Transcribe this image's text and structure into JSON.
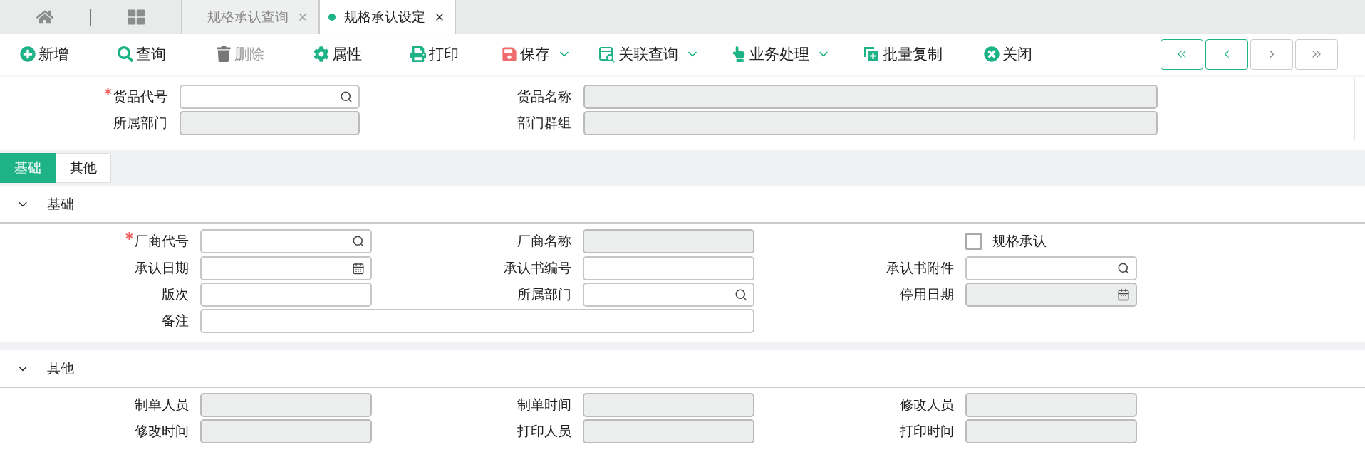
{
  "page_tabs": [
    {
      "label": "规格承认查询",
      "selected": false
    },
    {
      "label": "规格承认设定",
      "selected": true
    }
  ],
  "toolbar": [
    {
      "kind": "add",
      "label": "新增",
      "disabled": false,
      "dropdown": false
    },
    {
      "kind": "search",
      "label": "查询",
      "disabled": false,
      "dropdown": false
    },
    {
      "kind": "delete",
      "label": "删除",
      "disabled": true,
      "dropdown": false
    },
    {
      "kind": "settings",
      "label": "属性",
      "disabled": false,
      "dropdown": false
    },
    {
      "kind": "print",
      "label": "打印",
      "disabled": false,
      "dropdown": false
    },
    {
      "kind": "save",
      "label": "保存",
      "disabled": false,
      "dropdown": true
    },
    {
      "kind": "link",
      "label": "关联查询",
      "disabled": false,
      "dropdown": true
    },
    {
      "kind": "hand",
      "label": "业务处理",
      "disabled": false,
      "dropdown": true
    },
    {
      "kind": "copy",
      "label": "批量复制",
      "disabled": false,
      "dropdown": false
    },
    {
      "kind": "close",
      "label": "关闭",
      "disabled": false,
      "dropdown": false
    }
  ],
  "nav_buttons": [
    {
      "kind": "first",
      "disabled": false
    },
    {
      "kind": "prev",
      "disabled": false
    },
    {
      "kind": "next",
      "disabled": true
    },
    {
      "kind": "last",
      "disabled": true
    }
  ],
  "header_rows": [
    [
      {
        "label": "货品代号",
        "required": true,
        "readonly": false,
        "lookup": true
      },
      {
        "label": "货品名称",
        "required": false,
        "readonly": true
      }
    ],
    [
      {
        "label": "所属部门",
        "required": false,
        "readonly": true
      },
      {
        "label": "部门群组",
        "required": false,
        "readonly": true
      }
    ]
  ],
  "form_tabs": [
    {
      "label": "基础",
      "selected": true
    },
    {
      "label": "其他",
      "selected": false
    }
  ],
  "sections": [
    {
      "title": "基础",
      "expanded": true,
      "rows": [
        [
          {
            "kind": "text",
            "label": "厂商代号",
            "required": true,
            "readonly": false,
            "lookup": true
          },
          {
            "kind": "text",
            "label": "厂商名称",
            "required": false,
            "readonly": true
          },
          {
            "kind": "checkbox",
            "label": "规格承认",
            "checked": false
          }
        ],
        [
          {
            "kind": "text",
            "label": "承认日期",
            "required": false,
            "readonly": false,
            "date_picker": true
          },
          {
            "kind": "text",
            "label": "承认书编号",
            "required": false,
            "readonly": false
          },
          {
            "kind": "text",
            "label": "承认书附件",
            "required": false,
            "readonly": false,
            "lookup": true
          }
        ],
        [
          {
            "kind": "text",
            "label": "版次",
            "required": false,
            "readonly": false
          },
          {
            "kind": "text",
            "label": "所属部门",
            "required": false,
            "readonly": false,
            "lookup": true
          },
          {
            "kind": "text",
            "label": "停用日期",
            "required": false,
            "readonly": true,
            "date_picker": true
          }
        ],
        [
          {
            "kind": "wide",
            "label": "备注",
            "required": false,
            "readonly": false
          }
        ]
      ]
    },
    {
      "title": "其他",
      "expanded": true,
      "rows": [
        [
          {
            "kind": "text",
            "label": "制单人员",
            "required": false,
            "readonly": true
          },
          {
            "kind": "text",
            "label": "制单时间",
            "required": false,
            "readonly": true
          },
          {
            "kind": "text",
            "label": "修改人员",
            "required": false,
            "readonly": true
          }
        ],
        [
          {
            "kind": "text",
            "label": "修改时间",
            "required": false,
            "readonly": true
          },
          {
            "kind": "text",
            "label": "打印人员",
            "required": false,
            "readonly": true
          },
          {
            "kind": "text",
            "label": "打印时间",
            "required": false,
            "readonly": true
          }
        ]
      ]
    }
  ]
}
